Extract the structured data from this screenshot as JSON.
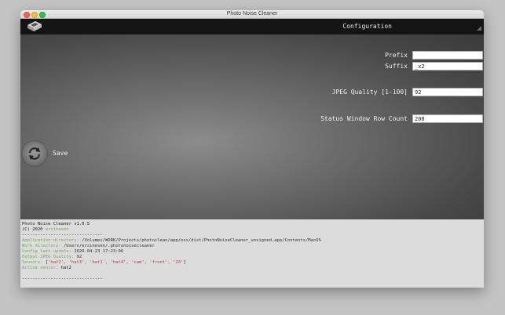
{
  "window": {
    "title": "Photo Noise Cleaner"
  },
  "header": {
    "title": "Configuration"
  },
  "form": {
    "prefix": {
      "label": "Prefix",
      "value": ""
    },
    "suffix": {
      "label": "Suffix",
      "value": "_x2"
    },
    "jpeg_quality": {
      "label": "JPEG Quality [1-100]",
      "value": "92"
    },
    "status_rows": {
      "label": "Status Window Row Count",
      "value": "200"
    }
  },
  "save": {
    "label": "Save"
  },
  "console": {
    "version": "Photo Noise Cleaner v1.0.5",
    "copyright_prefix": "(C) 2020 ",
    "copyright_author": "ersinesen",
    "separator": "-------------------------------",
    "app_dir_key": "Application directory: ",
    "app_dir_val": "/Volumes/WORK/Projects/photoclean/app/osx/dist/PhotoNoiseCleaner_unsigned.app/Contents/MacOS",
    "work_dir_key": "Work directory: ",
    "work_dir_val": "/Users/ersinesen/.photonoisecleaner",
    "config_key": "Config last update: ",
    "config_val": "2020-04-23 17:23:06",
    "quality_key": "Output JPEG Quality: ",
    "quality_val": "92",
    "sensors_key": "Sensors: ",
    "sensors_open": "[",
    "sensors_list": "'hat2', 'hat3', 'hat1', 'hat4', 'cam', 'front', '24'",
    "sensors_close": "]",
    "active_key": "Active sensor: ",
    "active_val": "hat2"
  }
}
